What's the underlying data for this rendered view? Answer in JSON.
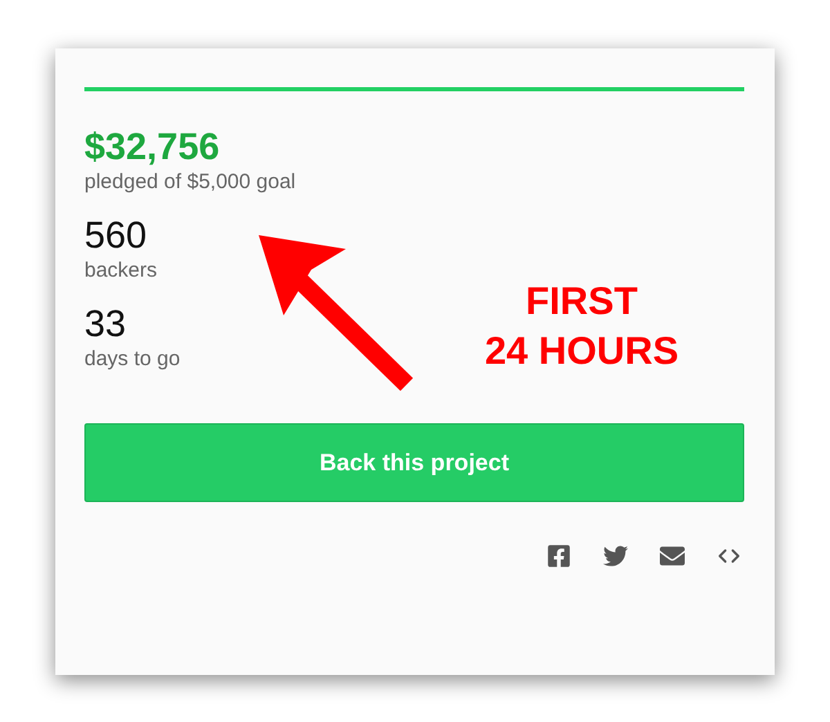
{
  "progress": {
    "level": 1
  },
  "stats": [
    {
      "value": "$32,756",
      "label": "pledged of $5,000 goal",
      "kind": "money"
    },
    {
      "value": "560",
      "label": "backers",
      "kind": "count"
    },
    {
      "value": "33",
      "label": "days to go",
      "kind": "count"
    }
  ],
  "button": "Back this project",
  "share": [
    {
      "kind": "facebook"
    },
    {
      "kind": "twitter"
    },
    {
      "kind": "email"
    },
    {
      "kind": "embed"
    }
  ],
  "annotation": {
    "lines": [
      "FIRST",
      "24 HOURS"
    ]
  }
}
